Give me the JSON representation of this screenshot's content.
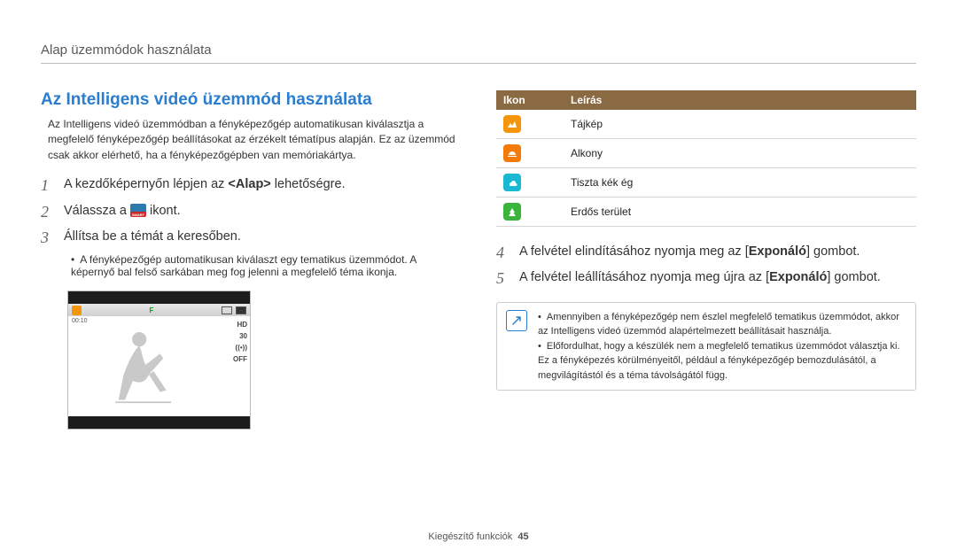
{
  "header": {
    "breadcrumb": "Alap üzemmódok használata"
  },
  "section": {
    "title": "Az Intelligens videó üzemmód használata",
    "intro": "Az Intelligens videó üzemmódban a fényképezőgép automatikusan kiválasztja a megfelelő fényképezőgép beállításokat az érzékelt tématípus alapján. Ez az üzemmód csak akkor elérhető, ha a fényképezőgépben van memóriakártya."
  },
  "steps_left": [
    {
      "num": "1",
      "pre": "A kezdőképernyőn lépjen az ",
      "bold": "<Alap>",
      "post": " lehetőségre."
    },
    {
      "num": "2",
      "pre": "Válassza a ",
      "icon": true,
      "post": " ikont."
    },
    {
      "num": "3",
      "pre": "Állítsa be a témát a keresőben.",
      "bold": "",
      "post": ""
    }
  ],
  "sub_bullets": [
    "A fényképezőgép automatikusan kiválaszt egy tematikus üzemmódot. A képernyő bal felső sarkában meg fog jelenni a megfelelő téma ikonja."
  ],
  "preview": {
    "f_badge": "F",
    "time": "00:10",
    "hd": "HD",
    "thirty": "30",
    "off": "OFF"
  },
  "icon_table": {
    "head_icon": "Ikon",
    "head_desc": "Leírás",
    "rows": [
      {
        "icon": "landscape-icon",
        "color": "sq-orange",
        "label": "Tájkép"
      },
      {
        "icon": "sunset-icon",
        "color": "sq-orange2",
        "label": "Alkony"
      },
      {
        "icon": "blue-sky-icon",
        "color": "sq-cyan",
        "label": "Tiszta kék ég"
      },
      {
        "icon": "forest-icon",
        "color": "sq-green",
        "label": "Erdős terület"
      }
    ]
  },
  "steps_right": [
    {
      "num": "4",
      "pre": "A felvétel elindításához nyomja meg az [",
      "bold": "Exponáló",
      "post": "] gombot."
    },
    {
      "num": "5",
      "pre": "A felvétel leállításához nyomja meg újra az [",
      "bold": "Exponáló",
      "post": "] gombot."
    }
  ],
  "note": {
    "items": [
      "Amennyiben a fényképezőgép nem észlel megfelelő tematikus üzemmódot, akkor az Intelligens videó üzemmód alapértelmezett beállításait használja.",
      "Előfordulhat, hogy a készülék nem a megfelelő tematikus üzemmódot választja ki. Ez a fényképezés körülményeitől, például a fényképezőgép bemozdulásától, a megvilágítástól és a téma távolságától függ."
    ]
  },
  "footer": {
    "label": "Kiegészítő funkciók",
    "page": "45"
  }
}
